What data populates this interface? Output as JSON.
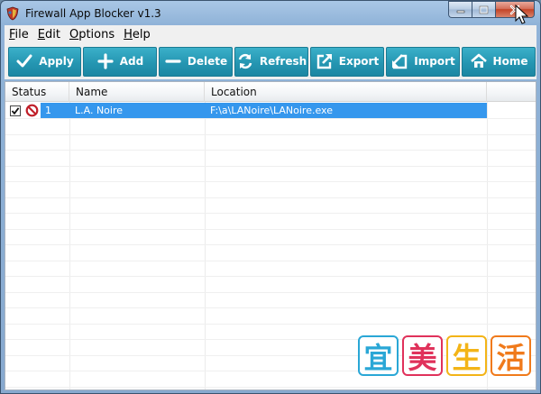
{
  "window": {
    "title": "Firewall App Blocker v1.3"
  },
  "menu": [
    {
      "label": "File",
      "ul": "F",
      "rest": "ile"
    },
    {
      "label": "Edit",
      "ul": "E",
      "rest": "dit"
    },
    {
      "label": "Options",
      "ul": "O",
      "rest": "ptions"
    },
    {
      "label": "Help",
      "ul": "H",
      "rest": "elp"
    }
  ],
  "toolbar": {
    "apply": "Apply",
    "add": "Add",
    "delete": "Delete",
    "refresh": "Refresh",
    "export": "Export",
    "import": "Import",
    "home": "Home"
  },
  "list": {
    "columns": [
      "Status",
      "Name",
      "Location"
    ],
    "rows": [
      {
        "checked": true,
        "blocked": true,
        "index": "1",
        "name": "L.A. Noire",
        "location": "F:\\a\\LANoire\\LANoire.exe"
      }
    ]
  },
  "colors": {
    "toolbar_button": "#2596b2",
    "selection": "#3597ed",
    "title_bar": "#90b3d8"
  },
  "watermark": {
    "chars": [
      "宜",
      "美",
      "生",
      "活"
    ],
    "colors": [
      "#2aa7d6",
      "#e0325b",
      "#f3b417",
      "#f07a1b"
    ]
  }
}
